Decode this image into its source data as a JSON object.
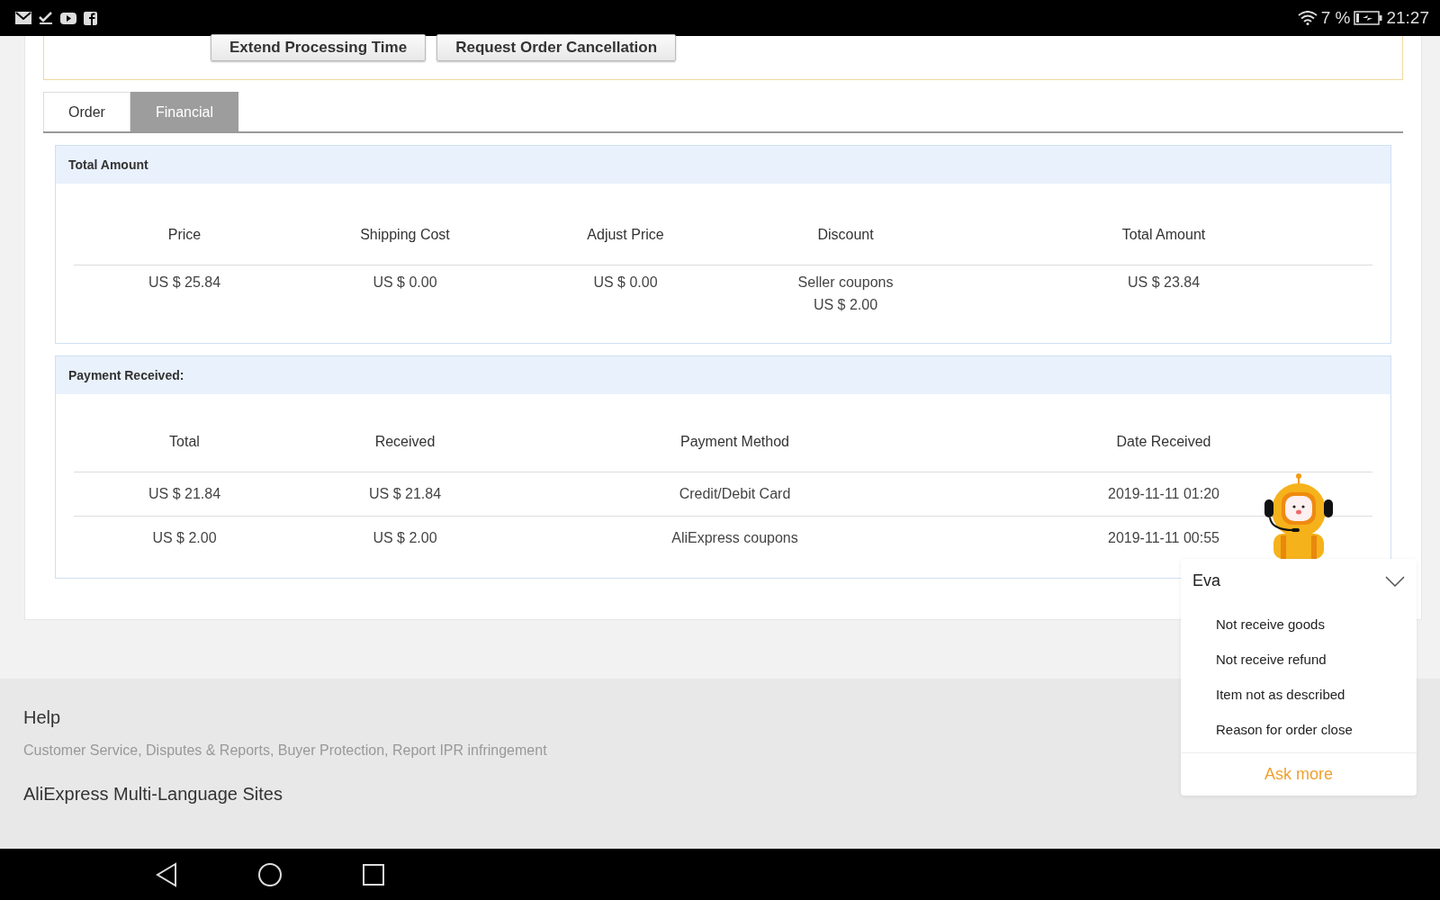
{
  "status_bar": {
    "battery": "7 %",
    "time": "21:27"
  },
  "actions": [
    "Extend Processing Time",
    "Request Order Cancellation"
  ],
  "tabs": [
    {
      "label": "Order",
      "selected": false
    },
    {
      "label": "Financial",
      "selected": true
    }
  ],
  "total_amount": {
    "title": "Total Amount",
    "columns": [
      "Price",
      "Shipping Cost",
      "Adjust Price",
      "Discount",
      "Total Amount"
    ],
    "rows": [
      [
        [
          "US $ 25.84"
        ],
        [
          "US $ 0.00"
        ],
        [
          "US $ 0.00"
        ],
        [
          "Seller coupons",
          "US $ 2.00"
        ],
        [
          "US $ 23.84"
        ]
      ]
    ]
  },
  "payment_received": {
    "title": "Payment Received:",
    "columns": [
      "Total",
      "Received",
      "Payment Method",
      "Date Received"
    ],
    "rows": [
      [
        "US $ 21.84",
        "US $ 21.84",
        "Credit/Debit Card",
        "2019-11-11 01:20"
      ],
      [
        "US $ 2.00",
        "US $ 2.00",
        "AliExpress coupons",
        "2019-11-11 00:55"
      ]
    ]
  },
  "footer": {
    "sections": [
      {
        "heading": "Help",
        "text": "Customer Service, Disputes & Reports, Buyer Protection, Report IPR infringement"
      },
      {
        "heading": "AliExpress Multi-Language Sites"
      }
    ]
  },
  "assistant": {
    "name": "Eva",
    "expanded": true,
    "questions": [
      "Not receive goods",
      "Not receive refund",
      "Item not as described",
      "Reason for order close"
    ],
    "ask_more": "Ask more"
  }
}
